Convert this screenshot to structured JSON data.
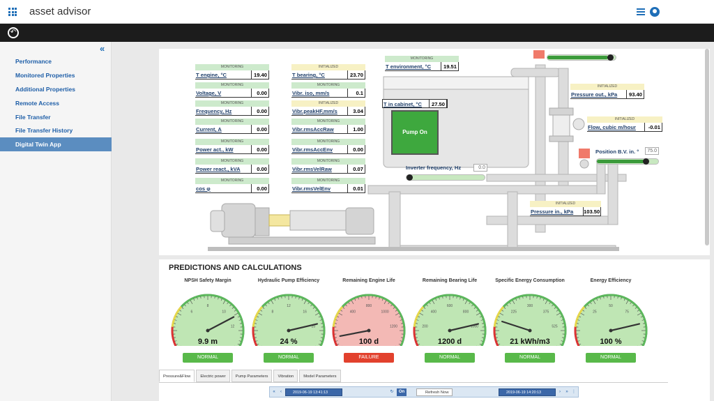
{
  "app": {
    "title": "asset advisor"
  },
  "sidebar": {
    "items": [
      {
        "label": "Performance"
      },
      {
        "label": "Monitored Properties"
      },
      {
        "label": "Additional Properties"
      },
      {
        "label": "Remote Access"
      },
      {
        "label": "File Transfer"
      },
      {
        "label": "File Transfer History"
      },
      {
        "label": "Digital Twin App",
        "active": true
      }
    ]
  },
  "twin": {
    "left_metrics": [
      {
        "status": "MONITORING",
        "label": "T engine, °C",
        "value": "19.40"
      },
      {
        "status": "MONITORING",
        "label": "Voltage, V",
        "value": "0.00"
      },
      {
        "status": "MONITORING",
        "label": "Frequency, Hz",
        "value": "0.00"
      },
      {
        "status": "MONITORING",
        "label": "Current, A",
        "value": "0.00"
      },
      {
        "status": "MONITORING",
        "label": "Power act., kW",
        "value": "0.00"
      },
      {
        "status": "MONITORING",
        "label": "Power react., kVA",
        "value": "0.00"
      },
      {
        "status": "MONITORING",
        "label": "cos φ",
        "value": "0.00"
      }
    ],
    "mid_metrics": [
      {
        "status": "INITIALIZED",
        "label": "T bearing, °C",
        "value": "23.70"
      },
      {
        "status": "MONITORING",
        "label": "Vibr. iso, mm/s",
        "value": "0.1"
      },
      {
        "status": "INITIALIZED",
        "label": "Vibr.peakHF,mm/s",
        "value": "3.04"
      },
      {
        "status": "MONITORING",
        "label": "Vibr.rmsAccRaw",
        "value": "1.00"
      },
      {
        "status": "MONITORING",
        "label": "Vibr.rmsAccEnv",
        "value": "0.00"
      },
      {
        "status": "MONITORING",
        "label": "Vibr.rmsVelRaw",
        "value": "0.07"
      },
      {
        "status": "MONITORING",
        "label": "Vibr.rmsVelEnv",
        "value": "0.01"
      }
    ],
    "t_environment": {
      "status": "MONITORING",
      "label": "T environment, °C",
      "value": "19.51"
    },
    "t_cabinet": {
      "label": "T in cabinet, °C",
      "value": "27.50"
    },
    "pump_button": "Pump On",
    "inverter": {
      "label": "Inverter frequency, Hz",
      "value": "0.0",
      "slider_fraction": 0.0
    },
    "pressure_out": {
      "status": "INITIALIZED",
      "label": "Pressure out., kPa",
      "value": "93.40"
    },
    "flow": {
      "status": "INITIALIZED",
      "label": "Flow, cubic m/hour",
      "value": "-0.01"
    },
    "position_bv": {
      "label": "Position B.V. in. °",
      "value": "75.0",
      "slider_fraction": 0.83
    },
    "top_valve_slider_fraction": 0.95,
    "pressure_in": {
      "status": "INITIALIZED",
      "label": "Pressure in., kPa",
      "value": "103.50"
    }
  },
  "predictions": {
    "title": "PREDICTIONS AND CALCULATIONS",
    "gauges": [
      {
        "title": "NPSH Safety Margin",
        "value": "9.9  m",
        "status": "NORMAL",
        "fail": false,
        "needle": 0.76,
        "ticks": [
          "",
          "6",
          "8",
          "10",
          "12"
        ],
        "face": "#bfe6b4"
      },
      {
        "title": "Hydraulic Pump Efficiency",
        "value": "24 %",
        "status": "NORMAL",
        "fail": false,
        "needle": 0.82,
        "ticks": [
          "",
          "8",
          "12",
          "16",
          "20"
        ],
        "face": "#bfe6b4"
      },
      {
        "title": "Remaining Engine Life",
        "value": "100 d",
        "status": "FAILURE",
        "fail": true,
        "needle": 0.08,
        "ticks": [
          "",
          "400",
          "800",
          "1000",
          "1200"
        ],
        "face": "#f3b9b5"
      },
      {
        "title": "Remaining Bearing Life",
        "value": "1200 d",
        "status": "NORMAL",
        "fail": false,
        "needle": 0.82,
        "ticks": [
          "200",
          "400",
          "600",
          "800",
          "1000"
        ],
        "face": "#bfe6b4"
      },
      {
        "title": "Specific Energy Consumption",
        "value": "21 kWh/m3",
        "status": "NORMAL",
        "fail": false,
        "needle": 0.2,
        "ticks": [
          "",
          "225",
          "300",
          "375",
          "525"
        ],
        "face": "#bfe6b4"
      },
      {
        "title": "Energy Efficiency",
        "value": "100 %",
        "status": "NORMAL",
        "fail": false,
        "needle": 0.82,
        "ticks": [
          "",
          "25",
          "50",
          "75",
          ""
        ],
        "face": "#bfe6b4"
      }
    ]
  },
  "tabs": [
    {
      "label": "Pressure&Flow",
      "active": true
    },
    {
      "label": "Electric power"
    },
    {
      "label": "Pump Parameters"
    },
    {
      "label": "Vibration"
    },
    {
      "label": "Model Parameters"
    }
  ],
  "timebar": {
    "start": "2019-06-19 13:41:13",
    "on_label": "On",
    "refresh_label": "Refresh Now",
    "end": "2019-06-19 14:20:13"
  },
  "colors": {
    "accent": "#1f6fb8",
    "normal": "#59b94a",
    "failure": "#e2412d",
    "pump_on": "#3ea83e"
  }
}
